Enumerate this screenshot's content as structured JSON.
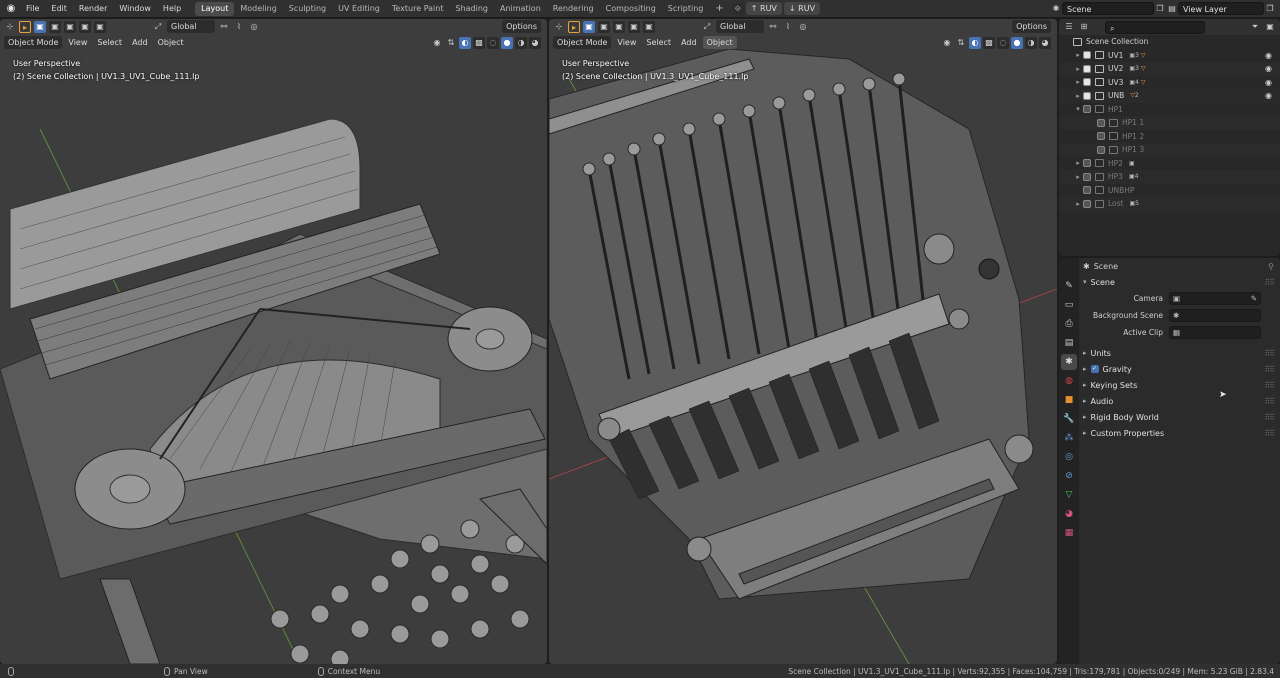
{
  "menubar": {
    "menus": [
      "File",
      "Edit",
      "Render",
      "Window",
      "Help"
    ],
    "workspaces": [
      "Layout",
      "Modeling",
      "Sculpting",
      "UV Editing",
      "Texture Paint",
      "Shading",
      "Animation",
      "Rendering",
      "Compositing",
      "Scripting"
    ],
    "active_workspace": "Layout",
    "add_tab": "+",
    "ruv_up": "RUV",
    "ruv_down": "RUV",
    "scene_name": "Scene",
    "view_layer": "View Layer"
  },
  "viewport_left": {
    "transform_orientation": "Global",
    "options": "Options",
    "mode": "Object Mode",
    "menus": [
      "View",
      "Select",
      "Add",
      "Object"
    ],
    "perspective": "User Perspective",
    "collection_info": "(2) Scene Collection | UV1.3_UV1_Cube_111.lp"
  },
  "viewport_right": {
    "transform_orientation": "Global",
    "options": "Options",
    "mode": "Object Mode",
    "menus": [
      "View",
      "Select",
      "Add",
      "Object"
    ],
    "perspective": "User Perspective",
    "collection_info": "(2) Scene Collection | UV1.3_UV1_Cube_111.lp"
  },
  "outliner": {
    "root": "Scene Collection",
    "rows": [
      {
        "label": "UV1",
        "badge": "3",
        "enabled": true
      },
      {
        "label": "UV2",
        "badge": "3",
        "enabled": true
      },
      {
        "label": "UV3",
        "badge": "4",
        "enabled": true
      },
      {
        "label": "UNB",
        "badge": "2",
        "enabled": true
      },
      {
        "label": "HP1",
        "badge": "",
        "enabled": false
      },
      {
        "label": "HP1 1",
        "badge": "",
        "enabled": false
      },
      {
        "label": "HP1 2",
        "badge": "",
        "enabled": false
      },
      {
        "label": "HP1 3",
        "badge": "",
        "enabled": false
      },
      {
        "label": "HP2",
        "badge": "",
        "enabled": false
      },
      {
        "label": "HP3",
        "badge": "4",
        "enabled": false
      },
      {
        "label": "UNBHP",
        "badge": "",
        "enabled": false
      },
      {
        "label": "Lost",
        "badge": "5",
        "enabled": false
      }
    ]
  },
  "properties": {
    "context": "Scene",
    "panel": "Scene",
    "fields": [
      {
        "label": "Camera",
        "value": ""
      },
      {
        "label": "Background Scene",
        "value": ""
      },
      {
        "label": "Active Clip",
        "value": ""
      }
    ],
    "subpanels": [
      "Units",
      "Gravity",
      "Keying Sets",
      "Audio",
      "Rigid Body World",
      "Custom Properties"
    ]
  },
  "statusbar": {
    "pan": "Pan View",
    "context_menu": "Context Menu",
    "stats": "Scene Collection | UV1.3_UV1_Cube_111.lp | Verts:92,355 | Faces:104,759 | Tris:179,781 | Objects:0/249 | Mem: 5.23 GiB | 2.83.4"
  },
  "colors": {
    "accent_blue": "#4772b3",
    "ui_bg": "#303030",
    "viewport_bg": "#3d3d3d",
    "x_axis": "#c8404e",
    "y_axis": "#77a93a"
  }
}
